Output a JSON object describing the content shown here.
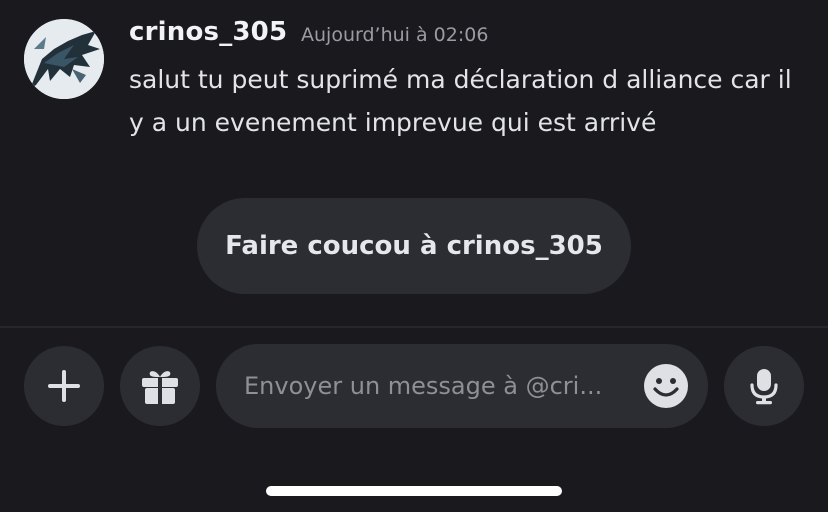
{
  "message": {
    "username": "crinos_305",
    "timestamp": "Aujourd’hui à 02:06",
    "text": "salut tu peut suprimé ma déclaration d alliance car il y a un evenement imprevue qui est arrivé",
    "avatar_icon": "raven-avatar"
  },
  "wave_button": {
    "label": "Faire coucou à crinos_305"
  },
  "composer": {
    "placeholder": "Envoyer un message à @cri...",
    "value": "",
    "add_icon": "plus-icon",
    "gift_icon": "gift-icon",
    "emoji_icon": "smiley-icon",
    "mic_icon": "microphone-icon"
  },
  "colors": {
    "background": "#1a1a1e",
    "button_bg": "#2c2d33",
    "text_primary": "#f2f3f5",
    "text_muted": "#9b9ca3"
  }
}
